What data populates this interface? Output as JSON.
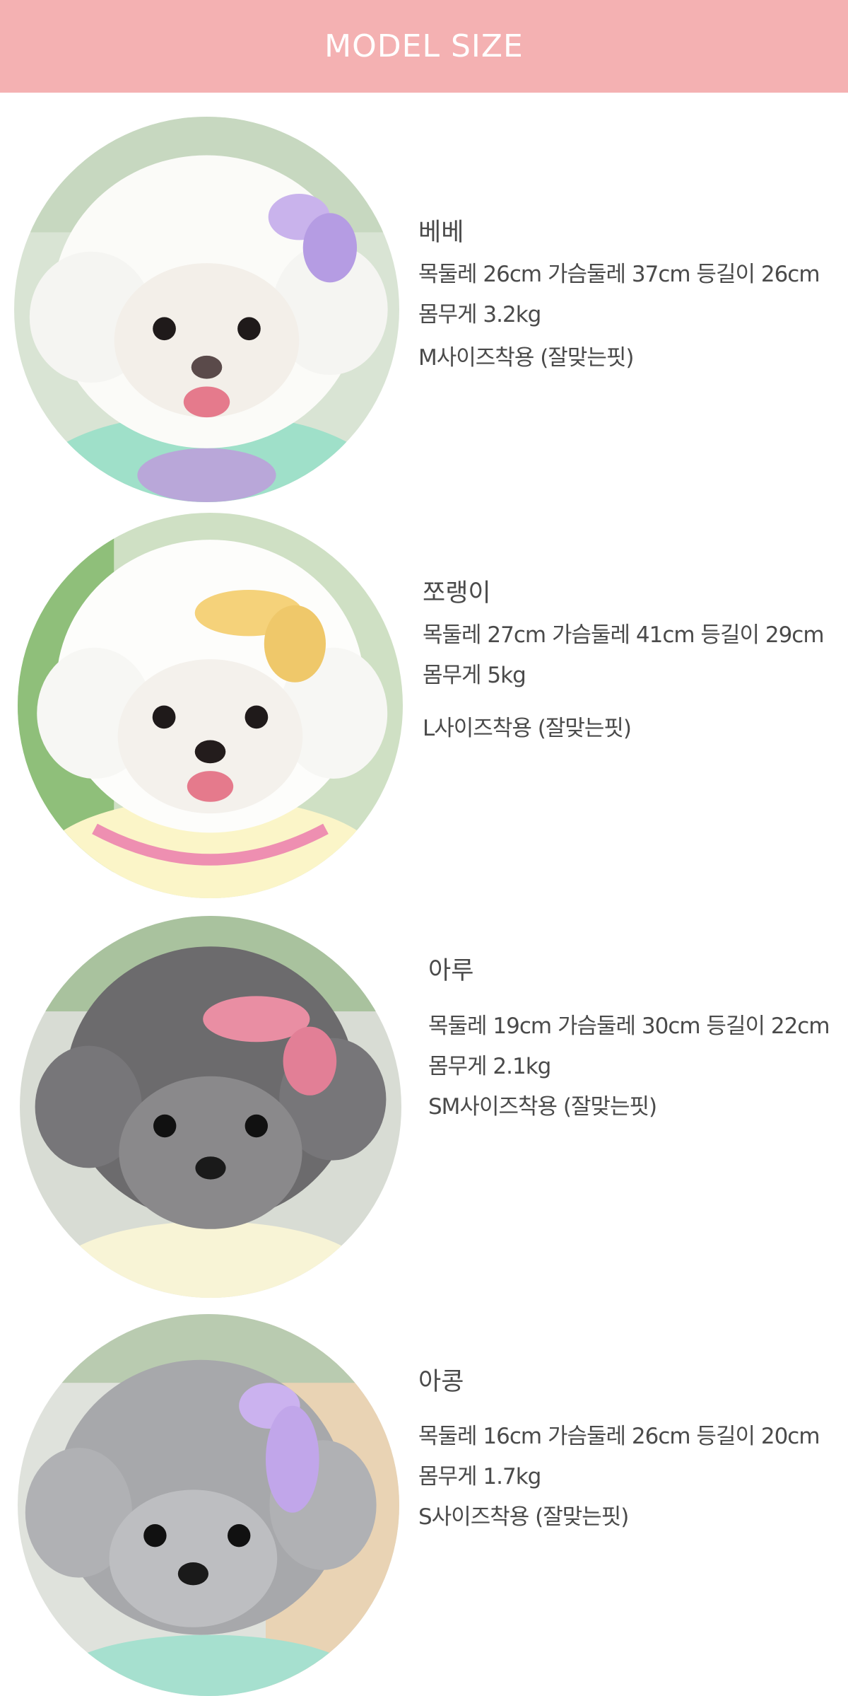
{
  "header": {
    "title": "MODEL SIZE",
    "color": "#f4b1b2"
  },
  "models": [
    {
      "name": "베베",
      "measurements": "목둘레 26cm  가슴둘레 37cm  등길이 26cm",
      "weight": "몸무게 3.2kg",
      "fit": "M사이즈착용 (잘맞는핏)",
      "photo_icon": "white-bichon-photo"
    },
    {
      "name": "쪼랭이",
      "measurements": "목둘레 27cm  가슴둘레 41cm  등길이 29cm",
      "weight": "몸무게 5kg",
      "fit": "L사이즈착용 (잘맞는핏)",
      "photo_icon": "white-bichon-yellow-bow-photo"
    },
    {
      "name": "아루",
      "measurements": "목둘레 19cm  가슴둘레 30cm  등길이 22cm",
      "weight": "몸무게 2.1kg",
      "fit": "SM사이즈착용 (잘맞는핏)",
      "photo_icon": "gray-poodle-pink-bow-photo"
    },
    {
      "name": "아콩",
      "measurements": "목둘레 16cm  가슴둘레 26cm  등길이 20cm",
      "weight": "몸무게 1.7kg",
      "fit": "S사이즈착용 (잘맞는핏)",
      "photo_icon": "gray-poodle-purple-bow-photo"
    }
  ]
}
